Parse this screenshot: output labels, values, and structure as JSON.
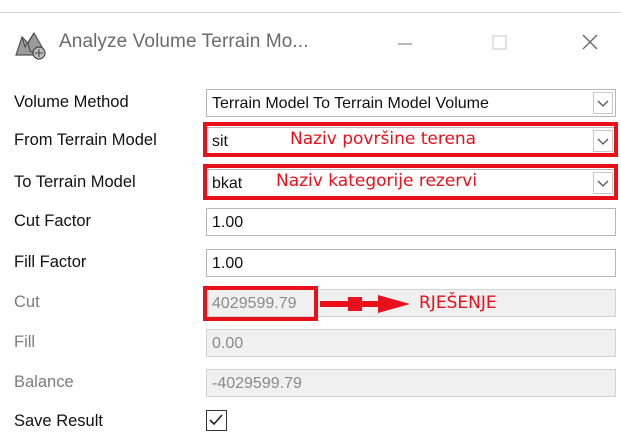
{
  "window": {
    "title": "Analyze Volume Terrain Mo...",
    "icon": "terrain-volume-app-icon"
  },
  "fields": {
    "volume_method": {
      "label": "Volume Method",
      "value": "Terrain Model To Terrain Model Volume"
    },
    "from_terrain_model": {
      "label": "From Terrain Model",
      "value": "sit"
    },
    "to_terrain_model": {
      "label": "To Terrain Model",
      "value": "bkat"
    },
    "cut_factor": {
      "label": "Cut Factor",
      "value": "1.00"
    },
    "fill_factor": {
      "label": "Fill Factor",
      "value": "1.00"
    },
    "cut": {
      "label": "Cut",
      "value": "4029599.79"
    },
    "fill": {
      "label": "Fill",
      "value": "0.00"
    },
    "balance": {
      "label": "Balance",
      "value": "-4029599.79"
    },
    "save_result": {
      "label": "Save Result",
      "checked": true
    }
  },
  "annotations": {
    "from_note": "Naziv površine terena",
    "to_note": "Naziv kategorije rezervi",
    "cut_note": "RJEŠENJE"
  },
  "colors": {
    "annotation_red": "#e8101a",
    "readonly_bg": "#f0f0f0"
  }
}
